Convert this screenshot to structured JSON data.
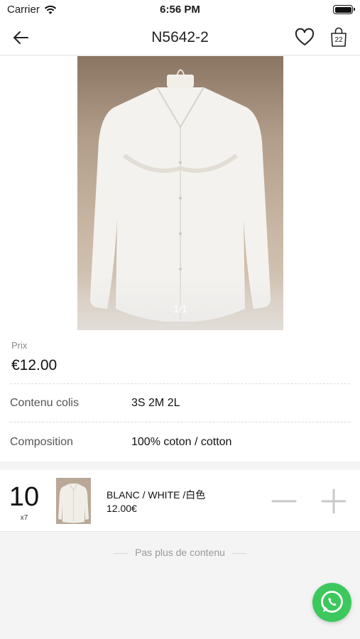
{
  "status_bar": {
    "carrier": "Carrier",
    "time": "6:56 PM"
  },
  "nav": {
    "title": "N5642-2",
    "bag_count": "22",
    "icons": [
      "back-arrow-icon",
      "heart-icon",
      "shopping-bag-icon"
    ]
  },
  "gallery": {
    "counter": "1/1"
  },
  "product": {
    "price_label": "Prix",
    "price": "€12.00",
    "rows": [
      {
        "label": "Contenu colis",
        "value": "3S 2M 2L"
      },
      {
        "label": "Composition",
        "value": "100% coton / cotton"
      }
    ]
  },
  "variant": {
    "quantity": "10",
    "multiplier": "x7",
    "name": "BLANC / WHITE /白色",
    "price": "12.00€"
  },
  "footer": {
    "end_note": "Pas plus de contenu"
  },
  "colors": {
    "whatsapp": "#3cc85c",
    "page_bg": "#f4f4f4"
  }
}
